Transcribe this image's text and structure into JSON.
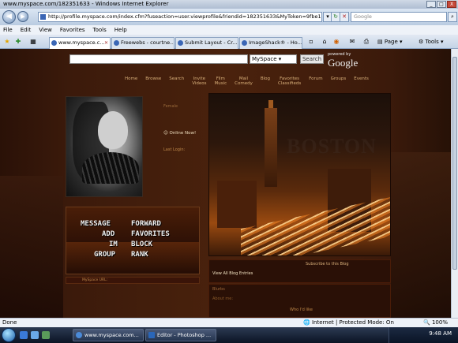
{
  "window": {
    "title": "www.myspace.com/182351633 - Windows Internet Explorer",
    "controls": [
      "_",
      "□",
      "X"
    ]
  },
  "address": {
    "url": "http://profile.myspace.com/index.cfm?fuseaction=user.viewprofile&friendid=182351633&MyToken=9fbe1eca-27!",
    "search_placeholder": "Google",
    "back_glyph": "◀",
    "forward_glyph": "▶"
  },
  "menu": [
    "File",
    "Edit",
    "View",
    "Favorites",
    "Tools",
    "Help"
  ],
  "tabs": [
    {
      "label": "www.myspace.c...",
      "active": true
    },
    {
      "label": "Freewebs - courtne...",
      "active": false
    },
    {
      "label": "Submit Layout - Cr...",
      "active": false
    },
    {
      "label": "ImageShack® - Ho...",
      "active": false
    }
  ],
  "toolbar": {
    "page_label": "Page",
    "tools_label": "Tools"
  },
  "myspace": {
    "search_select": "MySpace",
    "search_button": "Search",
    "powered_by": "powered by",
    "google_logo": "Google",
    "nav": [
      "Home",
      "Browse",
      "Search",
      "Invite",
      "Film",
      "Mail",
      "Blog",
      "Favorites",
      "Forum",
      "Groups",
      "Events"
    ],
    "nav2": [
      "Videos",
      "Music",
      "Comedy",
      "Classifieds"
    ]
  },
  "profile": {
    "online_now": "Online Now!",
    "side_lines": [
      "Female",
      "",
      "",
      ""
    ],
    "last_login": "Last Login:",
    "contact": {
      "message": "MESSAGE",
      "add": "ADD",
      "im": "IM",
      "group": "GROUP",
      "forward": "FORWARD",
      "favorites": "FAVORITES",
      "block": "BLOCK",
      "rank": "RANK"
    },
    "url_box": "MySpace URL:"
  },
  "main": {
    "boston_watermark": "BOSTON",
    "below_left": "",
    "below_right": "Subscribe to this Blog",
    "below_view": "View All Blog Entries",
    "sec_title": "Blurbs",
    "sec_line": "About me:",
    "sec_foot": "Who I'd like"
  },
  "status": {
    "left": "Done",
    "zone": "Internet | Protected Mode: On",
    "zoom": "100%"
  },
  "taskbar": {
    "buttons": [
      "www.myspace.com...",
      "Editor - Photoshop ..."
    ],
    "clock": "9:48 AM"
  }
}
